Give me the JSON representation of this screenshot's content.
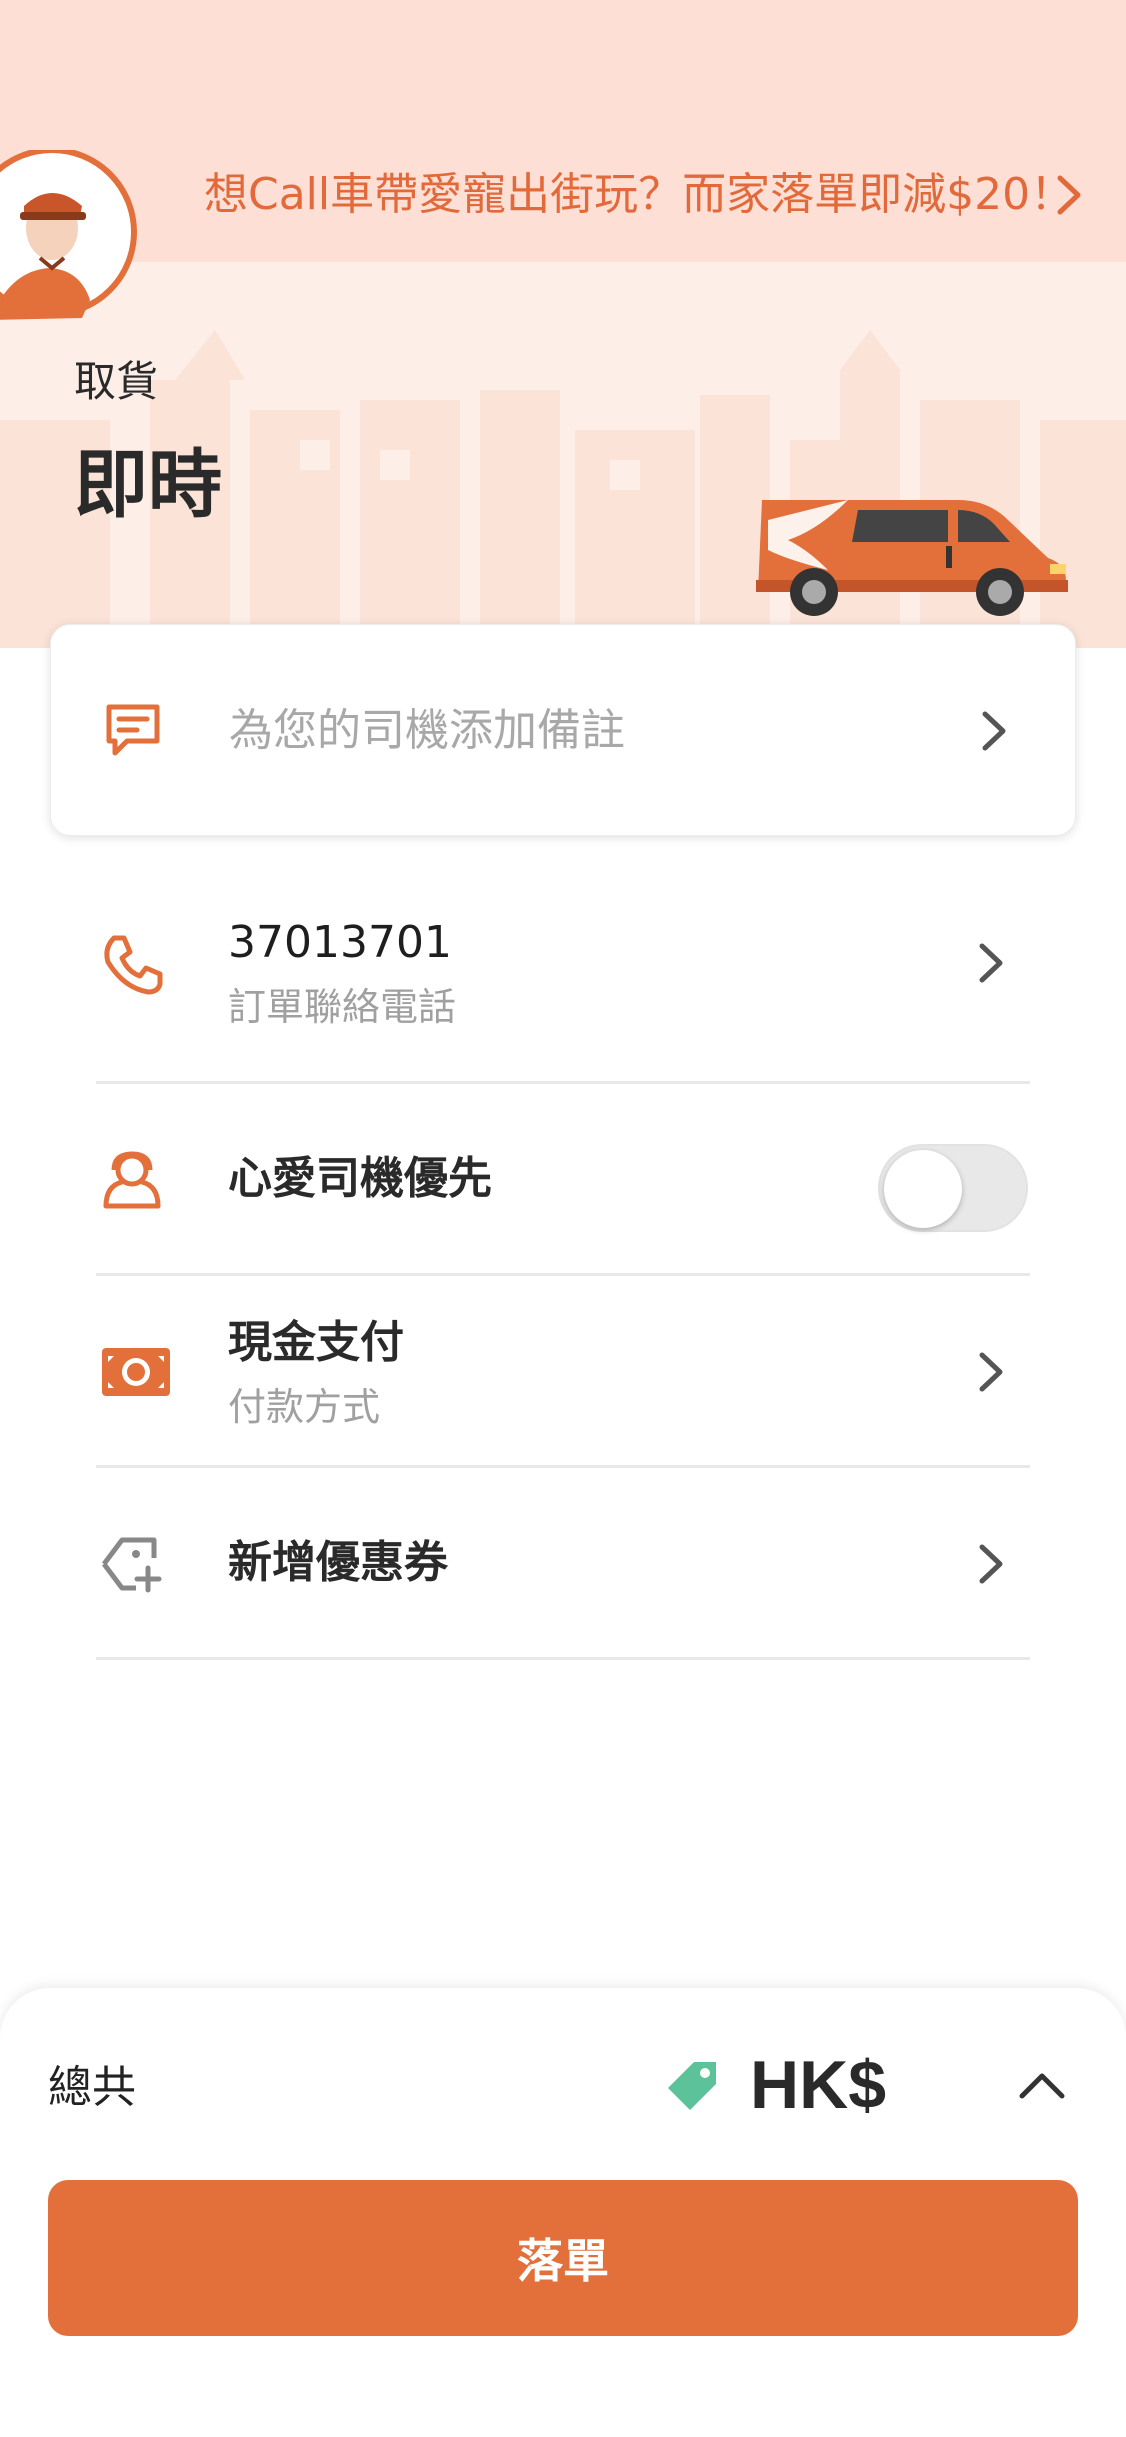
{
  "promo": {
    "text": "想Call車帶愛寵出街玩？而家落單即減$20！"
  },
  "pickup": {
    "label": "取貨",
    "time": "即時"
  },
  "note": {
    "placeholder": "為您的司機添加備註",
    "icon": "message-icon"
  },
  "rows": [
    {
      "name": "contact-phone",
      "main": "37013701",
      "sub": "訂單聯絡電話",
      "icon": "phone-icon"
    },
    {
      "name": "favorite-driver",
      "main": "心愛司機優先",
      "icon": "driver-icon",
      "toggle_on": false
    },
    {
      "name": "payment-method",
      "main": "現金支付",
      "sub": "付款方式",
      "icon": "cash-icon"
    },
    {
      "name": "add-coupon",
      "main": "新增優惠券",
      "icon": "coupon-icon"
    }
  ],
  "bottom": {
    "total_label": "總共",
    "currency": "HK$",
    "order_button": "落單"
  },
  "colors": {
    "accent": "#e36f3a",
    "promo_bg": "#fddfd6",
    "hero_bg": "#fdeee8",
    "tag_green": "#5cc29a"
  }
}
